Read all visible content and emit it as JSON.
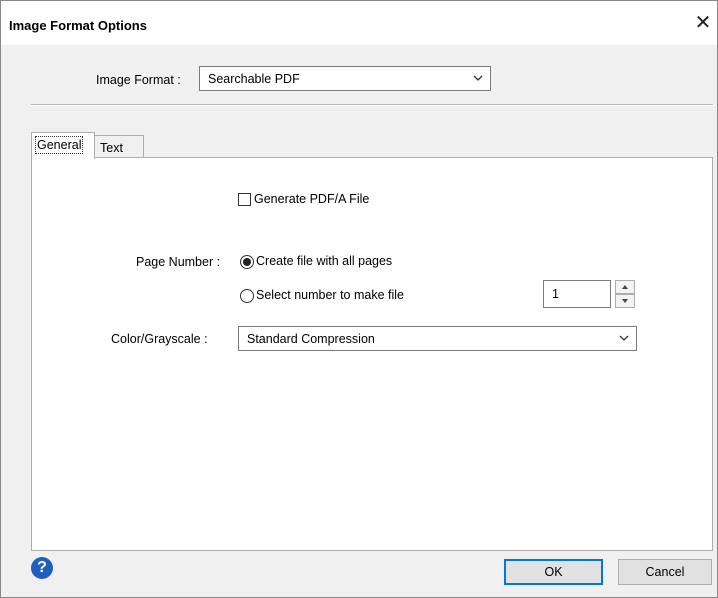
{
  "window": {
    "title": "Image Format Options"
  },
  "image_format": {
    "label": "Image Format :",
    "value": "Searchable PDF"
  },
  "tabs": [
    {
      "label": "General",
      "active": true
    },
    {
      "label": "Text",
      "active": false
    }
  ],
  "general": {
    "pdfa_checkbox": {
      "label": "Generate PDF/A File",
      "checked": false
    },
    "page_number": {
      "label": "Page Number :",
      "options": [
        {
          "label": "Create file with all pages",
          "selected": true
        },
        {
          "label": "Select number to make file",
          "selected": false
        }
      ],
      "spinner_value": "1"
    },
    "color_grayscale": {
      "label": "Color/Grayscale :",
      "value": "Standard Compression"
    }
  },
  "buttons": {
    "ok": "OK",
    "cancel": "Cancel"
  },
  "icons": {
    "help": "?",
    "close": "✕"
  },
  "colors": {
    "accent": "#0078d7",
    "help_icon": "#1f5fbf"
  }
}
